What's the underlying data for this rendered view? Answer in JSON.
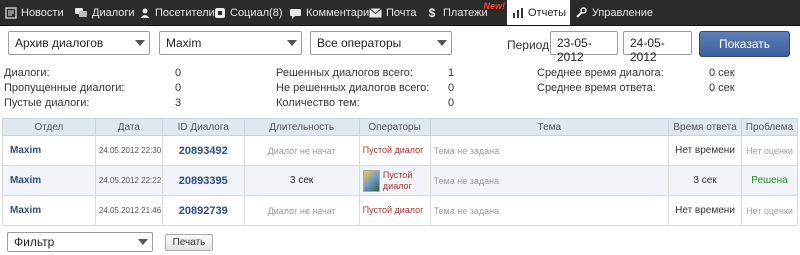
{
  "nav": {
    "items": [
      {
        "label": "Новости",
        "icon": "news-icon"
      },
      {
        "label": "Диалоги",
        "icon": "chat-bubbles-icon"
      },
      {
        "label": "Посетители",
        "icon": "user-icon"
      },
      {
        "label": "Социал(8)",
        "icon": "social-icon"
      },
      {
        "label": "Комментарии",
        "icon": "comments-icon"
      },
      {
        "label": "Почта",
        "icon": "envelope-icon"
      },
      {
        "label": "Платежи",
        "icon": "dollar-icon",
        "badge": "New!"
      },
      {
        "label": "Отчеты",
        "icon": "bar-chart-icon",
        "active": true
      },
      {
        "label": "Управление",
        "icon": "wrench-icon"
      }
    ]
  },
  "filters": {
    "report_type": "Архив диалогов",
    "department": "Maxim",
    "operators": "Все операторы",
    "period_label": "Период:",
    "date_from": "23-05-2012",
    "date_to": "24-05-2012",
    "show_button": "Показать"
  },
  "stats": {
    "col1": [
      {
        "label": "Диалоги:",
        "value": "0"
      },
      {
        "label": "Пропущенные диалоги:",
        "value": "0"
      },
      {
        "label": "Пустые диалоги:",
        "value": "3"
      }
    ],
    "col2": [
      {
        "label": "Решенных диалогов всего:",
        "value": "1"
      },
      {
        "label": "Не решенных диалогов всего:",
        "value": "0"
      },
      {
        "label": "Количество тем:",
        "value": "0"
      }
    ],
    "col3": [
      {
        "label": "Среднее время диалога:",
        "value": "0 сек"
      },
      {
        "label": "Среднее время ответа:",
        "value": "0 сек"
      }
    ]
  },
  "table": {
    "headers": [
      "Отдел",
      "Дата",
      "ID Диалога",
      "Длительность",
      "Операторы",
      "Тема",
      "Время ответа",
      "Проблема"
    ],
    "rows": [
      {
        "dept": "Maxim",
        "date": "24.05.2012 22:30",
        "id": "20893492",
        "duration": "Диалог не начат",
        "operator": "Пустой диалог",
        "avatar": false,
        "topic": "Тема не задана",
        "response": "Нет времени",
        "problem": "Нет оценки"
      },
      {
        "dept": "Maxim",
        "date": "24.05.2012 22:22",
        "id": "20893395",
        "duration": "3 сек",
        "operator": "Пустой диалог",
        "avatar": true,
        "topic": "Тема не задана",
        "response": "3 сек",
        "problem": "Решена"
      },
      {
        "dept": "Maxim",
        "date": "24.05.2012 21:46",
        "id": "20892739",
        "duration": "Диалог не начат",
        "operator": "Пустой диалог",
        "avatar": false,
        "topic": "Тема не задана",
        "response": "Нет времени",
        "problem": "Нет оценки"
      }
    ]
  },
  "bottom": {
    "filter_select": "Фильтр",
    "print_button": "Печать"
  }
}
